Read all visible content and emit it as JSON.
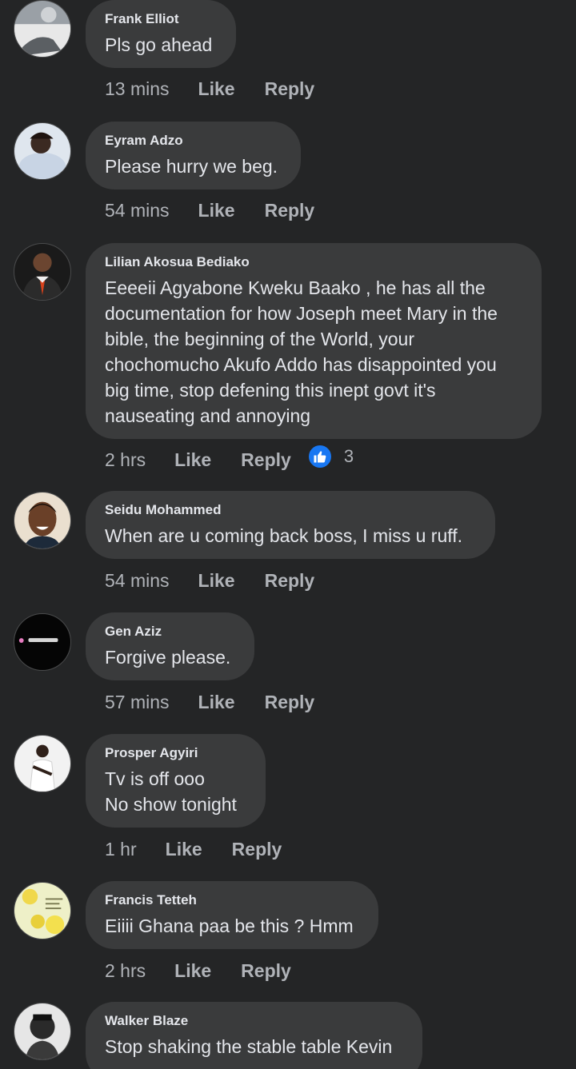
{
  "comments": [
    {
      "author": "Frank Elliot",
      "lines": [
        "Pls go ahead"
      ],
      "time": "13 mins",
      "like": "Like",
      "reply": "Reply",
      "avatar": "profile-photo-gray"
    },
    {
      "author": "Eyram Adzo",
      "lines": [
        "Please hurry we beg."
      ],
      "time": "54 mins",
      "like": "Like",
      "reply": "Reply",
      "avatar": "profile-photo-light"
    },
    {
      "author": "Lilian Akosua Bediako",
      "lines": [
        "Eeeeii Agyabone Kweku Baako , he has all the",
        "documentation for how Joseph meet Mary in the",
        "bible, the beginning of the World, your",
        "chochomucho Akufo Addo has disappointed you",
        "big time, stop defening this inept govt it's",
        "nauseating and annoying"
      ],
      "time": "2 hrs",
      "like": "Like",
      "reply": "Reply",
      "reaction_count": "3",
      "avatar": "profile-photo-suit"
    },
    {
      "author": "Seidu Mohammed",
      "lines": [
        "When are u coming back boss, I miss u ruff."
      ],
      "time": "54 mins",
      "like": "Like",
      "reply": "Reply",
      "avatar": "profile-photo-cartoon"
    },
    {
      "author": "Gen Aziz",
      "lines": [
        "Forgive please."
      ],
      "time": "57 mins",
      "like": "Like",
      "reply": "Reply",
      "avatar": "profile-photo-dark"
    },
    {
      "author": "Prosper Agyiri",
      "lines": [
        "Tv is off ooo",
        "No show tonight"
      ],
      "time": "1 hr",
      "like": "Like",
      "reply": "Reply",
      "avatar": "profile-photo-white-shirt"
    },
    {
      "author": "Francis Tetteh",
      "lines": [
        "Eiiii Ghana paa be this ? Hmm"
      ],
      "time": "2 hrs",
      "like": "Like",
      "reply": "Reply",
      "avatar": "profile-photo-flowers"
    },
    {
      "author": "Walker Blaze",
      "lines": [
        "Stop shaking the stable table Kevin"
      ],
      "avatar": "profile-photo-bw"
    }
  ],
  "colors": {
    "background": "#242526",
    "bubble": "#3a3b3c",
    "text": "#e4e6eb",
    "muted": "#b0b3b8",
    "like_blue": "#1877f2"
  }
}
